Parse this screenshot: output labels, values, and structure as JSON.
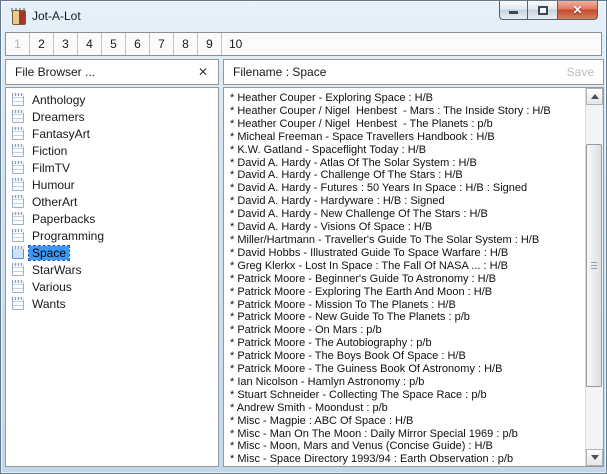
{
  "window": {
    "title": "Jot-A-Lot",
    "controls": {
      "minimize": "minimize",
      "maximize": "maximize",
      "close": "close"
    }
  },
  "colors": {
    "selection": "#3c97f6",
    "close_button": "#c64a2d",
    "titlebar": "#d3e4f2",
    "disabled_text": "#b4b4b4"
  },
  "toolbar": {
    "buttons": [
      "1",
      "2",
      "3",
      "4",
      "5",
      "6",
      "7",
      "8",
      "9",
      "10"
    ],
    "disabled_button": "1"
  },
  "file_browser": {
    "title": "File Browser ...",
    "close_glyph": "✕",
    "selected_item": "Space",
    "items": [
      "Anthology",
      "Dreamers",
      "FantasyArt",
      "Fiction",
      "FilmTV",
      "Humour",
      "OtherArt",
      "Paperbacks",
      "Programming",
      "Space",
      "StarWars",
      "Various",
      "Wants"
    ]
  },
  "editor": {
    "title": "Filename : Space",
    "save_label": "Save",
    "lines": [
      "* Heather Couper - Exploring Space : H/B",
      "* Heather Couper / Nigel  Henbest  - Mars : The Inside Story : H/B",
      "* Heather Couper / Nigel  Henbest  - The Planets : p/b",
      "* Micheal Freeman - Space Travellers Handbook : H/B",
      "* K.W. Gatland - Spaceflight Today : H/B",
      "* David A. Hardy - Atlas Of The Solar System : H/B",
      "* David A. Hardy - Challenge Of The Stars : H/B",
      "* David A. Hardy - Futures : 50 Years In Space : H/B : Signed",
      "* David A. Hardy - Hardyware : H/B : Signed",
      "* David A. Hardy - New Challenge Of The Stars : H/B",
      "* David A. Hardy - Visions Of Space : H/B",
      "* Miller/Hartmann - Traveller's Guide To The Solar System : H/B",
      "* David Hobbs - Illustrated Guide To Space Warfare : H/B",
      "* Greg Klerkx - Lost In Space : The Fall Of NASA ... : H/B",
      "* Patrick Moore - Beginner's Guide To Astronomy : H/B",
      "* Patrick Moore - Exploring The Earth And Moon : H/B",
      "* Patrick Moore - Mission To The Planets : H/B",
      "* Patrick Moore - New Guide To The Planets : p/b",
      "* Patrick Moore - On Mars : p/b",
      "* Patrick Moore - The Autobiography : p/b",
      "* Patrick Moore - The Boys Book Of Space : H/B",
      "* Patrick Moore - The Guiness Book Of Astronomy : H/B",
      "* Ian Nicolson - Hamlyn Astronomy : p/b",
      "* Stuart Schneider - Collecting The Space Race : p/b",
      "* Andrew Smith - Moondust : p/b",
      "* Misc - Magpie : ABC Of Space : H/B",
      "* Misc - Man On The Moon : Daily Mirror Special 1969 : p/b",
      "* Misc - Moon, Mars and Venus (Concise Guide) : H/B",
      "* Misc - Space Directory 1993/94 : Earth Observation : p/b"
    ]
  }
}
